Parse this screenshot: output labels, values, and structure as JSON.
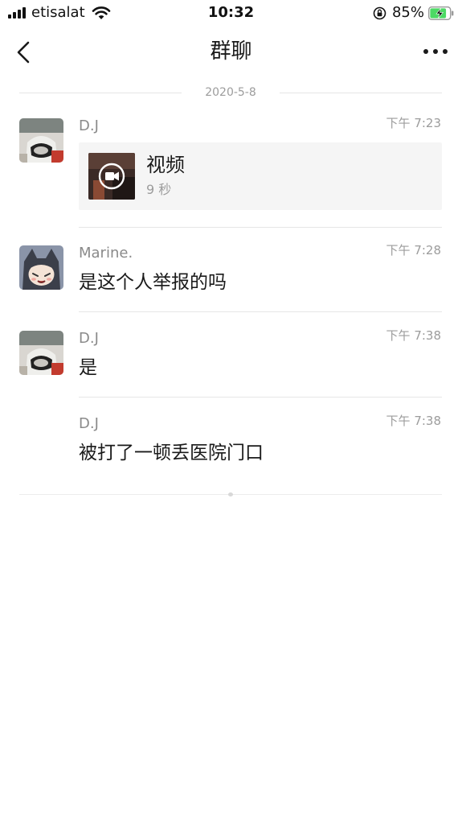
{
  "status_bar": {
    "carrier": "etisalat",
    "time": "10:32",
    "battery_percent": "85%",
    "battery_level": 0.85,
    "icons": [
      "signal-icon",
      "wifi-icon",
      "orientation-lock-icon",
      "battery-charging-icon"
    ]
  },
  "nav": {
    "title": "群聊",
    "icons": [
      "back-icon",
      "more-icon"
    ]
  },
  "date_divider": "2020-5-8",
  "messages": [
    {
      "sender": "D.J",
      "time": "下午 7:23",
      "type": "video",
      "video": {
        "title": "视频",
        "duration": "9 秒"
      }
    },
    {
      "sender": "Marine.",
      "time": "下午 7:28",
      "type": "text",
      "text": "是这个人举报的吗"
    },
    {
      "sender": "D.J",
      "time": "下午 7:38",
      "type": "text",
      "text": "是"
    },
    {
      "sender": "D.J",
      "time": "下午 7:38",
      "type": "text",
      "text": "被打了一顿丢医院门口"
    }
  ],
  "colors": {
    "background": "#ffffff",
    "secondary_text": "#9c9c9c",
    "card_background": "#f5f5f5",
    "battery_green": "#4cd964"
  }
}
